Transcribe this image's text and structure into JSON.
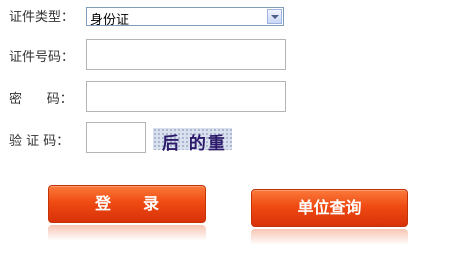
{
  "form": {
    "id_type_label": "证件类型：",
    "id_type_value": "身份证",
    "id_number_label": "证件号码：",
    "password_label": "密      码：",
    "captcha_label": "验 证 码：",
    "captcha_image_text": "后 的重"
  },
  "buttons": {
    "login_label": "登　　录",
    "unit_query_label": "单位查询"
  },
  "colors": {
    "button_gradient_top": "#fb7a3a",
    "button_gradient_bottom": "#d8310a",
    "captcha_text": "#2d1a6b"
  }
}
